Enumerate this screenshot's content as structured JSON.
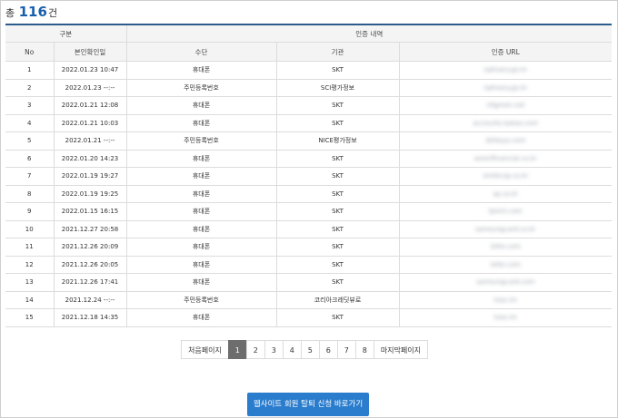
{
  "summary": {
    "prefix": "총",
    "count": "116",
    "suffix": "건"
  },
  "table": {
    "group_headers": {
      "category": "구분",
      "history": "인증 내역"
    },
    "columns": [
      "No",
      "본인확인일",
      "수단",
      "기관",
      "인증 URL"
    ],
    "rows": [
      {
        "no": "1",
        "date": "2022.01.23 10:47",
        "method": "휴대폰",
        "agency": "SKT",
        "url": "nphoary.go.kr"
      },
      {
        "no": "2",
        "date": "2022.01.23 --:--",
        "method": "주민등록번호",
        "agency": "SCI평가정보",
        "url": "nphoary.go.kr"
      },
      {
        "no": "3",
        "date": "2022.01.21 12:08",
        "method": "휴대폰",
        "agency": "SKT",
        "url": "nligmen.net"
      },
      {
        "no": "4",
        "date": "2022.01.21 10:03",
        "method": "휴대폰",
        "agency": "SKT",
        "url": "accounts.kakao.com"
      },
      {
        "no": "5",
        "date": "2022.01.21 --:--",
        "method": "주민등록번호",
        "agency": "NICE평가정보",
        "url": "dofasys.com"
      },
      {
        "no": "6",
        "date": "2022.01.20 14:23",
        "method": "휴대폰",
        "agency": "SKT",
        "url": "wooriftnancial.co.kr"
      },
      {
        "no": "7",
        "date": "2022.01.19 19:27",
        "method": "휴대폰",
        "agency": "SKT",
        "url": "smilecsp.co.kr"
      },
      {
        "no": "8",
        "date": "2022.01.19 19:25",
        "method": "휴대폰",
        "agency": "SKT",
        "url": "sp.co.kr"
      },
      {
        "no": "9",
        "date": "2022.01.15 16:15",
        "method": "휴대폰",
        "agency": "SKT",
        "url": "lpoint.com"
      },
      {
        "no": "10",
        "date": "2021.12.27 20:58",
        "method": "휴대폰",
        "agency": "SKT",
        "url": "samsungcard.co.kr"
      },
      {
        "no": "11",
        "date": "2021.12.26 20:09",
        "method": "휴대폰",
        "agency": "SKT",
        "url": "lotte.com"
      },
      {
        "no": "12",
        "date": "2021.12.26 20:05",
        "method": "휴대폰",
        "agency": "SKT",
        "url": "lotte.com"
      },
      {
        "no": "13",
        "date": "2021.12.26 17:41",
        "method": "휴대폰",
        "agency": "SKT",
        "url": "samsungcard.com"
      },
      {
        "no": "14",
        "date": "2021.12.24 --:--",
        "method": "주민등록번호",
        "agency": "코리아크레딧뷰로",
        "url": "toss.im"
      },
      {
        "no": "15",
        "date": "2021.12.18 14:35",
        "method": "휴대폰",
        "agency": "SKT",
        "url": "toss.im"
      }
    ]
  },
  "pagination": {
    "first": "처음페이지",
    "pages": [
      "1",
      "2",
      "3",
      "4",
      "5",
      "6",
      "7",
      "8"
    ],
    "current": "1",
    "last": "마지막페이지"
  },
  "cta": {
    "label": "웹사이트 회원 탈퇴 신청 바로가기"
  },
  "colors": {
    "accent": "#1a5fae",
    "header_border": "#2b5a8c",
    "button": "#2a7ccd",
    "active_page": "#6d6d6d"
  },
  "icons": []
}
